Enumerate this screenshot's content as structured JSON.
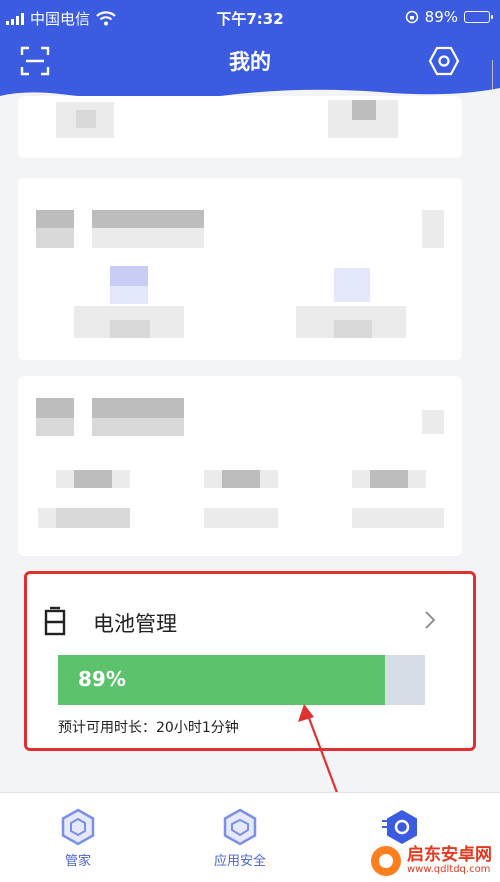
{
  "status_bar": {
    "carrier": "中国电信",
    "time": "下午7:32",
    "battery_text": "89%",
    "icons": [
      "signal-icon",
      "wifi-icon",
      "rotation-lock-icon",
      "battery-icon"
    ]
  },
  "nav": {
    "title": "我的",
    "left_icon": "scan-icon",
    "right_icon": "settings-hexagon-icon",
    "bar_color": "#3b5be0"
  },
  "battery_card": {
    "title": "电池管理",
    "percent_label": "89%",
    "percent_value": 89,
    "remaining": "预计可用时长：20小时1分钟",
    "fill_color": "#5cc26b",
    "highlight_color": "#e03131"
  },
  "tabs": [
    {
      "label": "管家",
      "icon": "hexagon-icon"
    },
    {
      "label": "应用安全",
      "icon": "shield-hexagon-icon"
    },
    {
      "label": "",
      "icon": "profile-hexagon-icon"
    }
  ],
  "watermark": {
    "name": "启东安卓网",
    "url": "www.qdltdq.com"
  }
}
